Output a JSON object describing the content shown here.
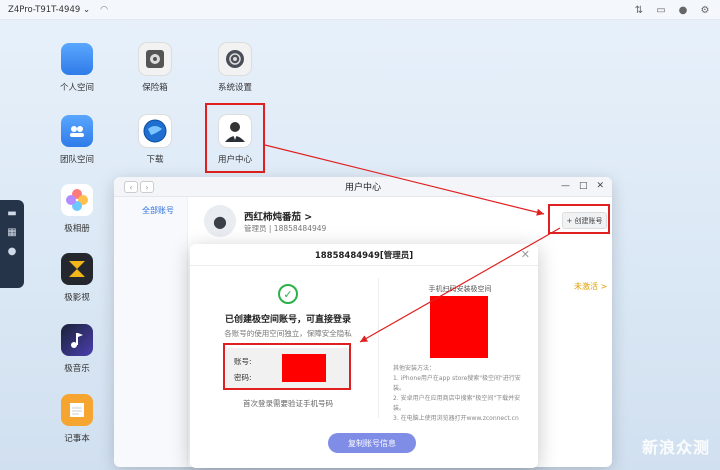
{
  "topbar": {
    "device_name": "Z4Pro-T91T-4949 ⌄",
    "icons": [
      "wifi-icon",
      "transfer-icon",
      "inbox-icon",
      "user-icon",
      "gear-icon"
    ]
  },
  "desktop": {
    "icons": [
      {
        "label": "个人空间",
        "icon": "folder-icon"
      },
      {
        "label": "保险箱",
        "icon": "safe-icon"
      },
      {
        "label": "系统设置",
        "icon": "settings-icon"
      },
      {
        "label": "团队空间",
        "icon": "team-folder-icon"
      },
      {
        "label": "下载",
        "icon": "download-globe-icon"
      },
      {
        "label": "用户中心",
        "icon": "user-center-icon"
      },
      {
        "label": "极相册",
        "icon": "photos-icon"
      },
      {
        "label": "极影视",
        "icon": "video-icon"
      },
      {
        "label": "极音乐",
        "icon": "music-icon"
      },
      {
        "label": "记事本",
        "icon": "notes-icon"
      }
    ]
  },
  "window": {
    "title": "用户中心",
    "sidebar_item": "全部账号",
    "account": {
      "name": "西红柿炖番茄 >",
      "role": "管理员 | 18858484949"
    },
    "create_button": "+ 创建账号",
    "inactive_label": "未激活 >"
  },
  "modal": {
    "title": "18858484949[管理员]",
    "success_title": "已创建极空间账号，可直接登录",
    "success_sub": "各账号的使用空间独立，保障安全隐私",
    "account_label": "账号:",
    "password_label": "密码:",
    "first_login": "首次登录需要验证手机号码",
    "qr_title": "手机扫码安装极空间",
    "instructions": [
      "其他安装方法：",
      "1. iPhone用户在app store搜索\"极空间\"进行安装。",
      "2. 安卓用户在应用商店中搜索\"极空间\"下载并安装。",
      "3. 在电脑上使用浏览器打开www.zconnect.cn"
    ],
    "copy_button": "复制账号信息"
  },
  "watermark": "新浪众测",
  "colors": {
    "accent": "#2d6fe0",
    "success": "#2ab24a",
    "highlight": "#e02020",
    "button": "#7f8de6"
  }
}
